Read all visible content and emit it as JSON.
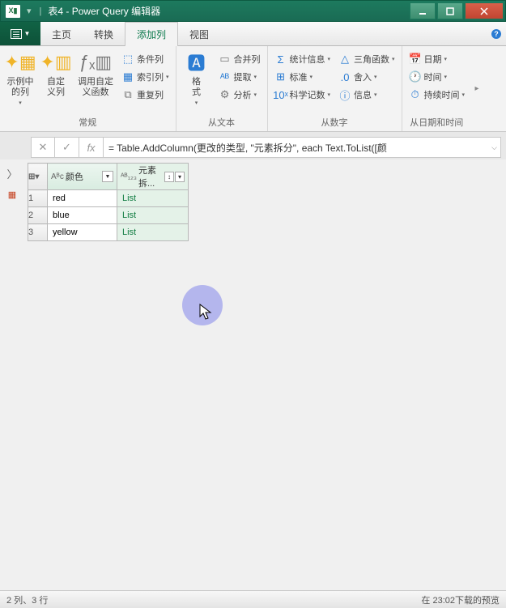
{
  "titlebar": {
    "title": "表4 - Power Query 编辑器"
  },
  "tabs": {
    "t1": "主页",
    "t2": "转换",
    "t3": "添加列",
    "t4": "视图"
  },
  "ribbon": {
    "g1": {
      "label": "常规",
      "b1": "示例中\n的列",
      "b2": "自定\n义列",
      "b3": "调用自定\n义函数",
      "s1": "条件列",
      "s2": "索引列",
      "s3": "重复列"
    },
    "g2": {
      "label": "从文本",
      "b1": "格\n式",
      "s1": "合并列",
      "s2": "提取",
      "s3": "分析"
    },
    "g3": {
      "label": "从数字",
      "s1": "统计信息",
      "s2": "标准",
      "s3": "科学记数",
      "s4": "三角函数",
      "s5": "舍入",
      "s6": "信息"
    },
    "g4": {
      "label": "从日期和时间",
      "s1": "日期",
      "s2": "时间",
      "s3": "持续时间"
    }
  },
  "formula": "= Table.AddColumn(更改的类型, \"元素拆分\", each Text.ToList([颜",
  "table": {
    "col1": "颜色",
    "col2": "元素拆...",
    "rows": [
      {
        "n": "1",
        "c1": "red",
        "c2": "List"
      },
      {
        "n": "2",
        "c1": "blue",
        "c2": "List"
      },
      {
        "n": "3",
        "c1": "yellow",
        "c2": "List"
      }
    ]
  },
  "status": {
    "left": "2 列、3 行",
    "right": "在 23:02下载的预览"
  }
}
